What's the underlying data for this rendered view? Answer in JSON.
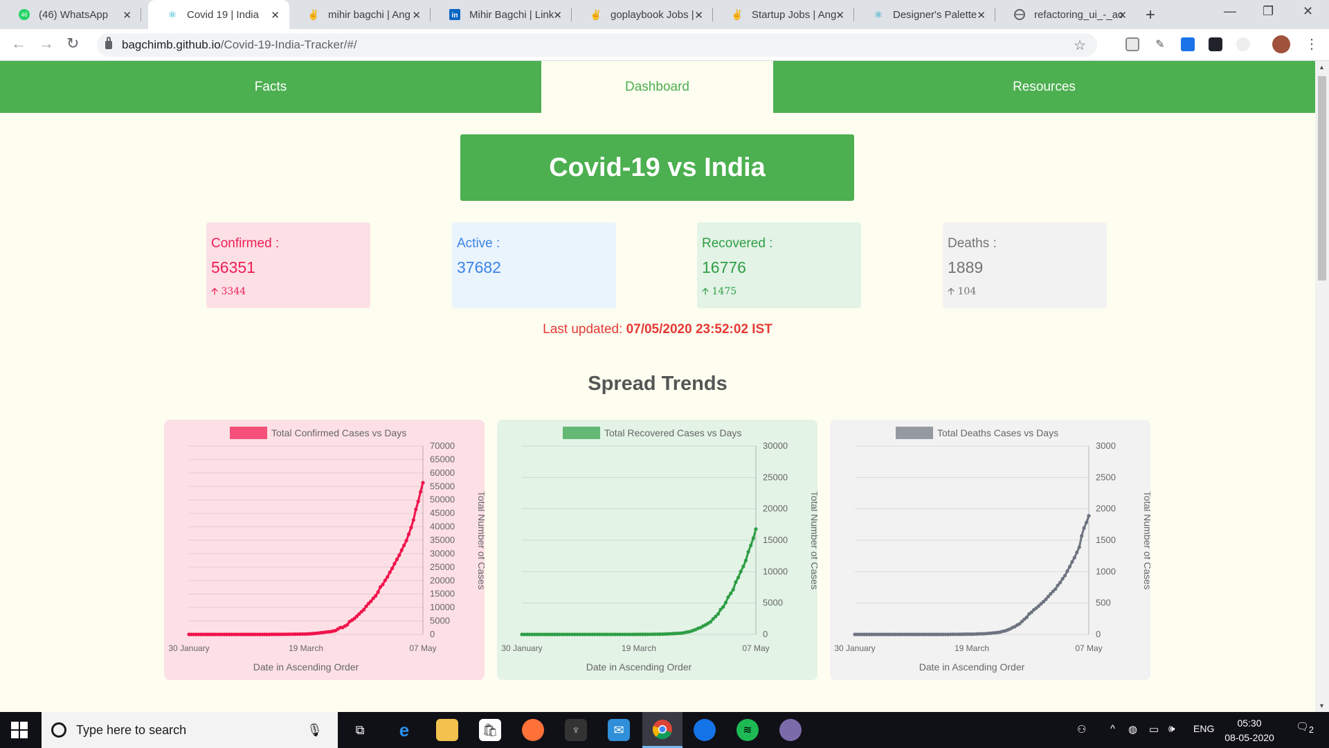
{
  "browser": {
    "tabs": [
      {
        "title": "(46) WhatsApp",
        "icon": "whatsapp-icon",
        "active": false
      },
      {
        "title": "Covid 19 | India",
        "icon": "react-icon",
        "active": true
      },
      {
        "title": "mihir bagchi | Ang",
        "icon": "angellist-icon",
        "active": false
      },
      {
        "title": "Mihir Bagchi | Link",
        "icon": "linkedin-icon",
        "active": false
      },
      {
        "title": "goplaybook Jobs |",
        "icon": "angellist-icon",
        "active": false
      },
      {
        "title": "Startup Jobs | Ang",
        "icon": "angellist-icon",
        "active": false
      },
      {
        "title": "Designer's Palette",
        "icon": "react-icon",
        "active": false
      },
      {
        "title": "refactoring_ui_-_ac",
        "icon": "globe-icon",
        "active": false
      }
    ],
    "url_host": "bagchimb.github.io",
    "url_path": "/Covid-19-India-Tracker/#/"
  },
  "nav": {
    "tabs": [
      {
        "label": "Facts",
        "active": false
      },
      {
        "label": "Dashboard",
        "active": true
      },
      {
        "label": "Resources",
        "active": false
      }
    ]
  },
  "hero": {
    "title": "Covid-19 vs India"
  },
  "stats": {
    "confirmed": {
      "label": "Confirmed :",
      "value": "56351",
      "delta": "3344",
      "color": "#ef1d52",
      "bg": "#fde0e6"
    },
    "active": {
      "label": "Active :",
      "value": "37682",
      "delta": "",
      "color": "#3a82e6",
      "bg": "#eaf4fd"
    },
    "recovered": {
      "label": "Recovered :",
      "value": "16776",
      "delta": "1475",
      "color": "#2e9e45",
      "bg": "#e3f3e6"
    },
    "deaths": {
      "label": "Deaths :",
      "value": "1889",
      "delta": "104",
      "color": "#737373",
      "bg": "#f2f2f2"
    }
  },
  "last_updated": {
    "label": "Last updated: ",
    "value": "07/05/2020 23:52:02 IST"
  },
  "section_title": "Spread Trends",
  "chart_data": [
    {
      "type": "line",
      "title": "Total Confirmed Cases vs Days",
      "xlabel": "Date in Ascending Order",
      "ylabel": "Total Number of Cases",
      "x_ticks": [
        "30 January",
        "19 March",
        "07 May"
      ],
      "ylim": [
        0,
        70000
      ],
      "y_ticks": [
        0,
        5000,
        10000,
        15000,
        20000,
        25000,
        30000,
        35000,
        40000,
        45000,
        50000,
        55000,
        60000,
        65000,
        70000
      ],
      "color": "#f0134b",
      "bg": "#fde0e6",
      "legend": "top",
      "grid": true,
      "series": [
        {
          "values": [
            1,
            1,
            1,
            3,
            3,
            3,
            3,
            3,
            3,
            3,
            3,
            3,
            3,
            3,
            3,
            3,
            3,
            3,
            3,
            3,
            3,
            3,
            3,
            3,
            3,
            3,
            3,
            3,
            3,
            3,
            3,
            3,
            3,
            5,
            6,
            29,
            30,
            31,
            34,
            39,
            44,
            50,
            73,
            75,
            83,
            90,
            108,
            116,
            137,
            151,
            173,
            223,
            283,
            360,
            434,
            536,
            657,
            727,
            887,
            987,
            1024,
            1251,
            1397,
            1998,
            2543,
            2567,
            3082,
            3588,
            4778,
            5311,
            5916,
            6725,
            7598,
            8446,
            9205,
            10453,
            11487,
            12322,
            13430,
            14352,
            15722,
            17615,
            18539,
            20080,
            21370,
            23077,
            24530,
            26283,
            27890,
            29451,
            31324,
            33062,
            34863,
            37257,
            39699,
            42505,
            46437,
            49400,
            52987,
            56351
          ]
        }
      ]
    },
    {
      "type": "line",
      "title": "Total Recovered Cases vs Days",
      "xlabel": "Date in Ascending Order",
      "ylabel": "Total Number of Cases",
      "x_ticks": [
        "30 January",
        "19 March",
        "07 May"
      ],
      "ylim": [
        0,
        30000
      ],
      "y_ticks": [
        0,
        5000,
        10000,
        15000,
        20000,
        25000,
        30000
      ],
      "color": "#2e9e45",
      "bg": "#e3f3e6",
      "legend": "top",
      "grid": true,
      "series": [
        {
          "values": [
            0,
            0,
            0,
            0,
            0,
            0,
            0,
            0,
            0,
            0,
            0,
            0,
            0,
            0,
            0,
            0,
            3,
            3,
            3,
            3,
            3,
            3,
            3,
            3,
            3,
            3,
            3,
            3,
            3,
            3,
            3,
            3,
            3,
            3,
            3,
            3,
            3,
            3,
            3,
            3,
            4,
            4,
            4,
            4,
            4,
            10,
            10,
            13,
            14,
            15,
            20,
            23,
            27,
            36,
            40,
            43,
            45,
            67,
            85,
            102,
            123,
            148,
            169,
            191,
            229,
            326,
            402,
            473,
            620,
            765,
            969,
            1080,
            1325,
            1514,
            1767,
            2004,
            2465,
            2854,
            3258,
            3975,
            4370,
            5062,
            5939,
            6523,
            7137,
            8325,
            9066,
            10007,
            10819,
            11775,
            13160,
            14183,
            15331,
            16776
          ]
        }
      ]
    },
    {
      "type": "line",
      "title": "Total Deaths Cases vs Days",
      "xlabel": "Date in Ascending Order",
      "ylabel": "Total Number of Cases",
      "x_ticks": [
        "30 January",
        "19 March",
        "07 May"
      ],
      "ylim": [
        0,
        3000
      ],
      "y_ticks": [
        0,
        500,
        1000,
        1500,
        2000,
        2500,
        3000
      ],
      "color": "#6e7380",
      "bg": "#f2f2f2",
      "legend": "top",
      "grid": true,
      "series": [
        {
          "values": [
            0,
            0,
            0,
            0,
            0,
            0,
            0,
            0,
            0,
            0,
            0,
            0,
            0,
            0,
            0,
            0,
            0,
            0,
            0,
            0,
            0,
            0,
            0,
            0,
            0,
            0,
            0,
            0,
            0,
            0,
            0,
            0,
            0,
            0,
            0,
            0,
            0,
            0,
            0,
            0,
            1,
            2,
            2,
            2,
            3,
            3,
            4,
            4,
            4,
            4,
            5,
            7,
            9,
            10,
            10,
            13,
            17,
            19,
            24,
            27,
            32,
            38,
            50,
            56,
            72,
            86,
            109,
            124,
            149,
            169,
            206,
            242,
            273,
            326,
            353,
            392,
            420,
            452,
            488,
            521,
            559,
            603,
            645,
            686,
            722,
            780,
            826,
            886,
            937,
            1008,
            1079,
            1154,
            1223,
            1306,
            1389,
            1568,
            1694,
            1783,
            1889
          ]
        }
      ]
    }
  ],
  "taskbar": {
    "search_placeholder": "Type here to search",
    "language": "ENG",
    "time": "05:30",
    "date": "08-05-2020",
    "notifications": "2"
  }
}
